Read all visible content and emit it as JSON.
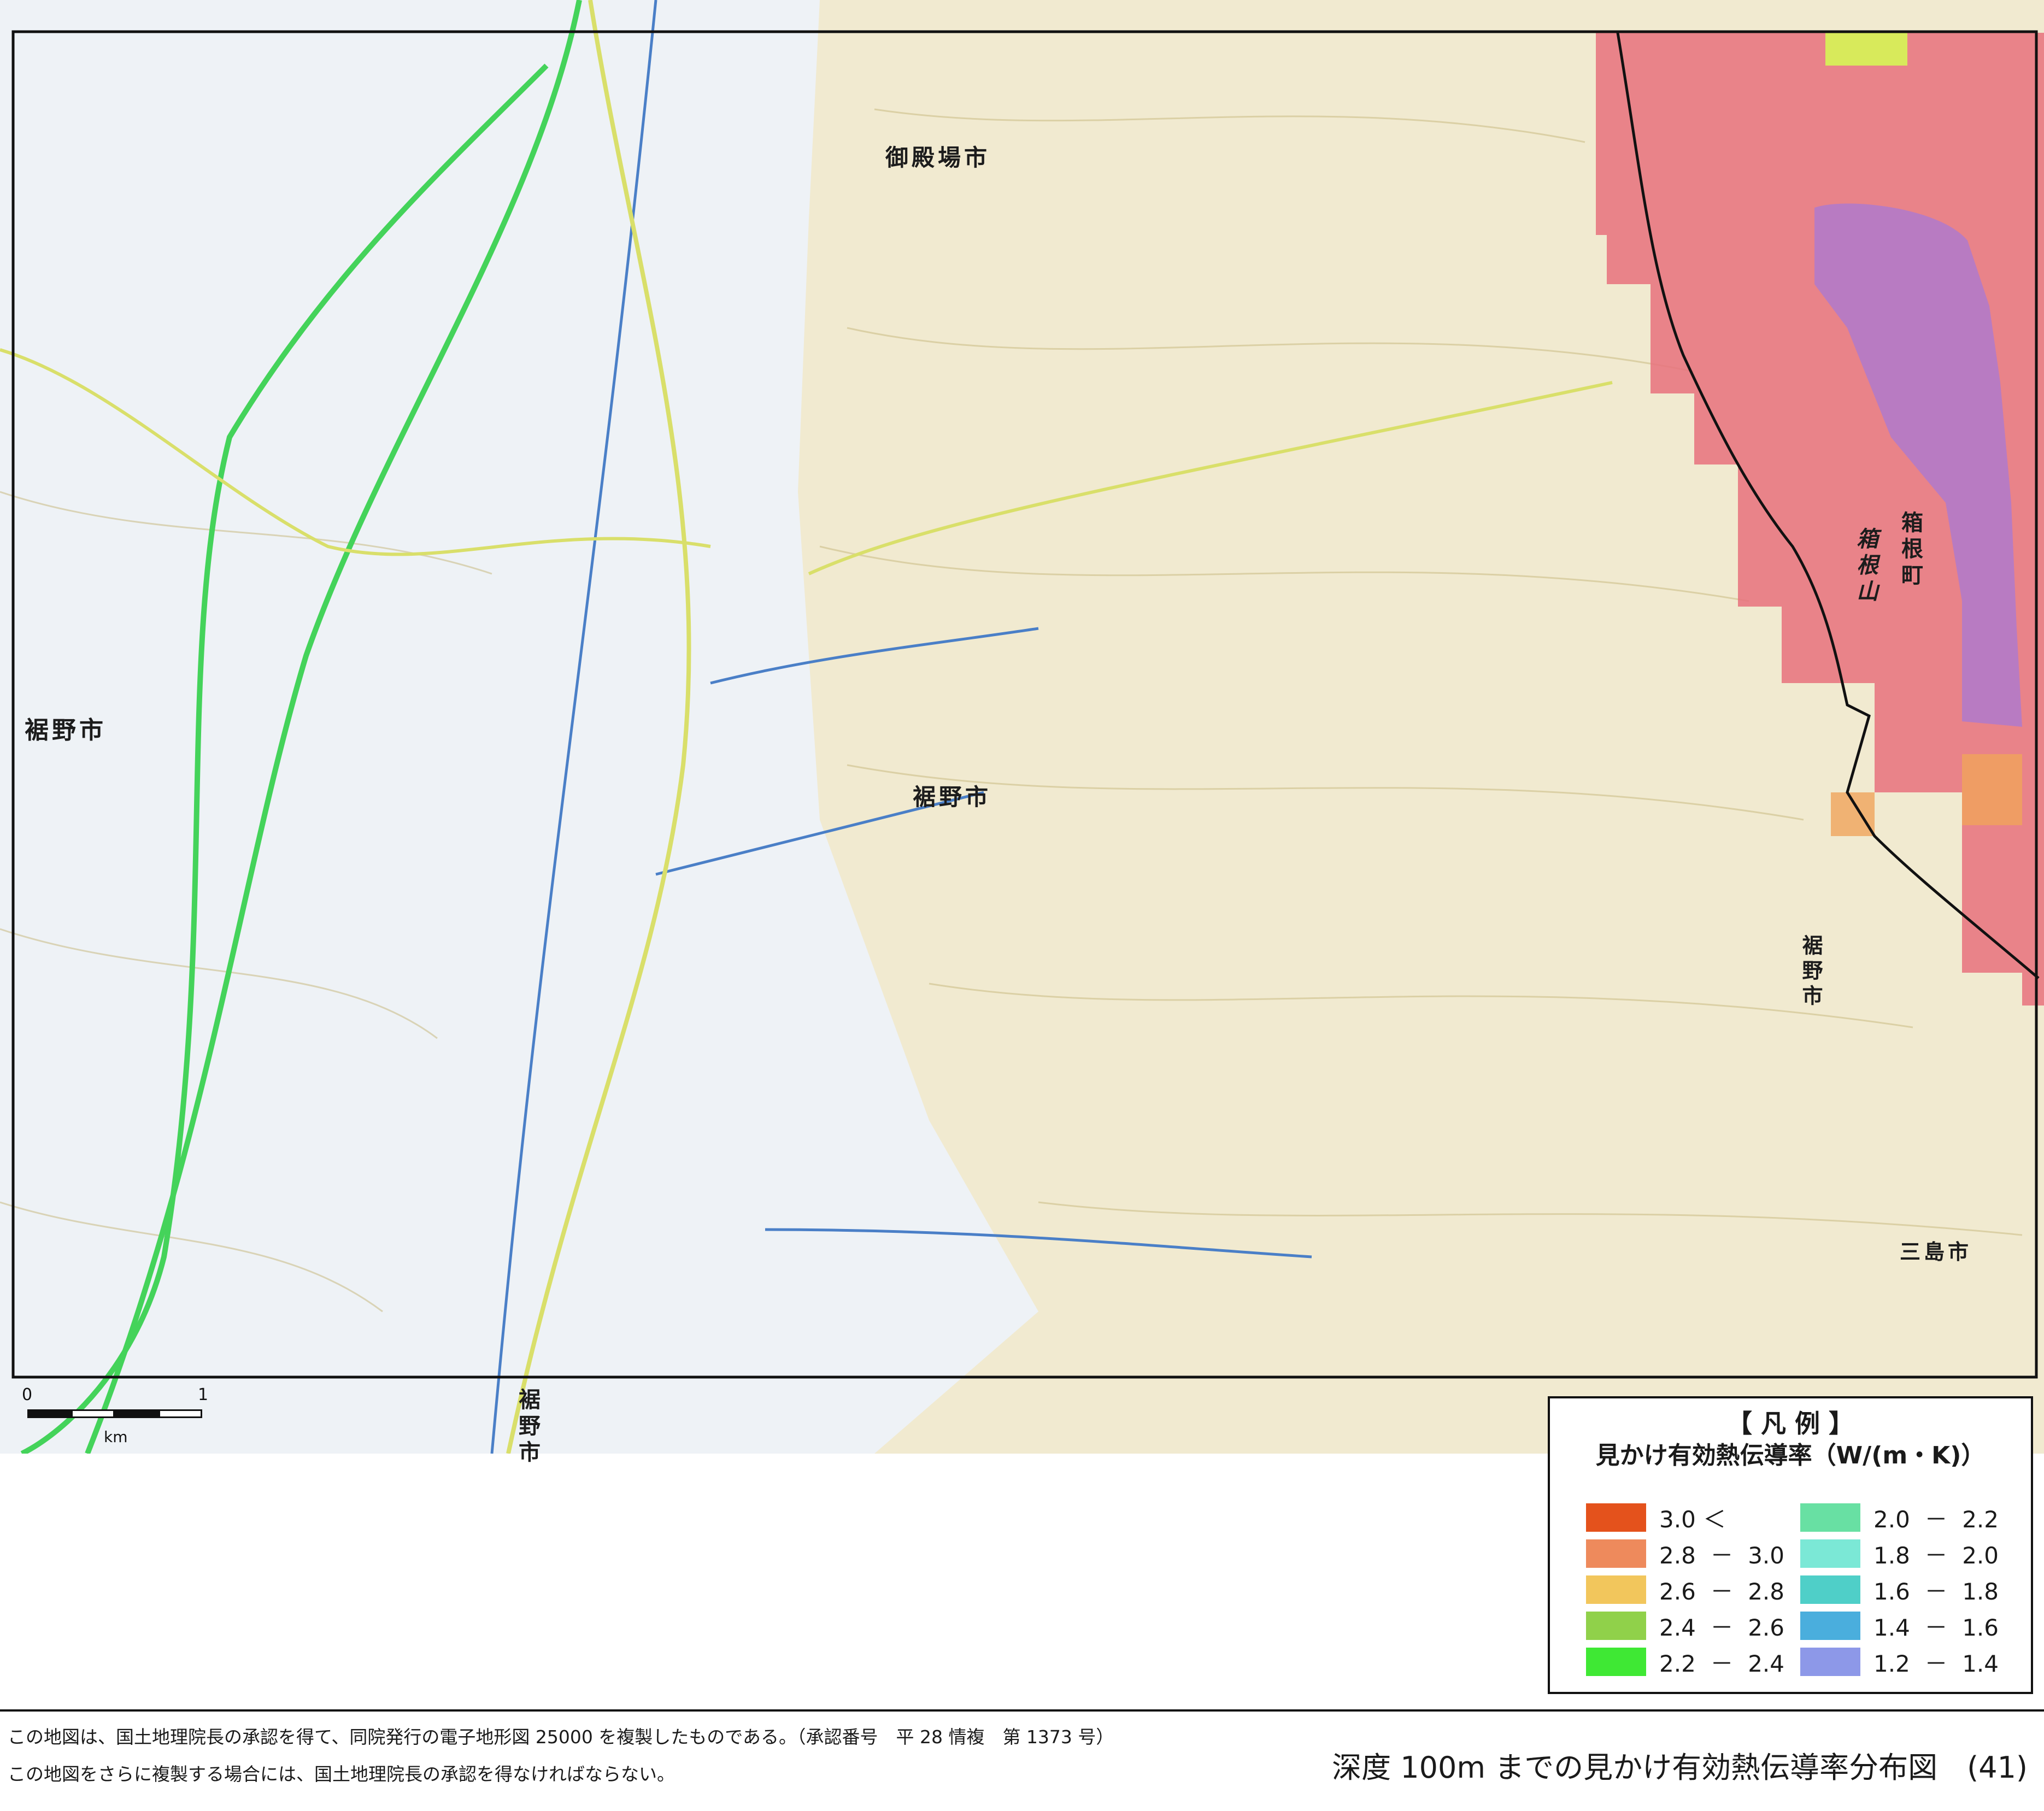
{
  "map": {
    "place_names": {
      "gotemba": "御殿場市",
      "susono_west": "裾野市",
      "susono_center": "裾野市",
      "susono_east": "裾野市",
      "susono_south": "裾野市",
      "hakone_town": "箱根町",
      "hakone_mountain": "箱根山",
      "mishima": "三島市"
    },
    "colors": {
      "terrain": "#f1ead0",
      "valley": "#eef2f6",
      "contour": "#c9b982",
      "river": "#4a7fc7",
      "expressway": "#44d35a",
      "national_road": "#d9df6a",
      "boundary": "#111111",
      "zone_1_2_1_4": "#b27ac9",
      "zone_2_8_3_0": "#e8717d",
      "zone_2_4_2_6": "#d8ea5b",
      "zone_2_6_2_8": "#f0a45b"
    }
  },
  "scale_bar": {
    "start": "0",
    "end": "1",
    "unit": "km"
  },
  "legend": {
    "title": "【 凡 例 】",
    "subtitle": "見かけ有効熱伝導率（W/(m・K)）",
    "items": [
      {
        "label": "3.0 ＜",
        "color": "#e4521c"
      },
      {
        "label": "2.8  －  3.0",
        "color": "#ee8a5c"
      },
      {
        "label": "2.6  －  2.8",
        "color": "#f2c65c"
      },
      {
        "label": "2.4  －  2.6",
        "color": "#90d14a"
      },
      {
        "label": "2.2  －  2.4",
        "color": "#3fe834"
      },
      {
        "label": "2.0  －  2.2",
        "color": "#68e0a3"
      },
      {
        "label": "1.8  －  2.0",
        "color": "#7be8d6"
      },
      {
        "label": "1.6  －  1.8",
        "color": "#4fcfc8"
      },
      {
        "label": "1.4  －  1.6",
        "color": "#4aaedd"
      },
      {
        "label": "1.2  －  1.4",
        "color": "#8d98e8"
      }
    ]
  },
  "footer": {
    "note_1": "この地図は、国土地理院長の承認を得て、同院発行の電子地形図 25000 を複製したものである。（承認番号　平 28 情複　第 1373 号）",
    "note_2": "この地図をさらに複製する場合には、国土地理院長の承認を得なければならない。",
    "title": "深度 100m までの見かけ有効熱伝導率分布図　(41)"
  }
}
